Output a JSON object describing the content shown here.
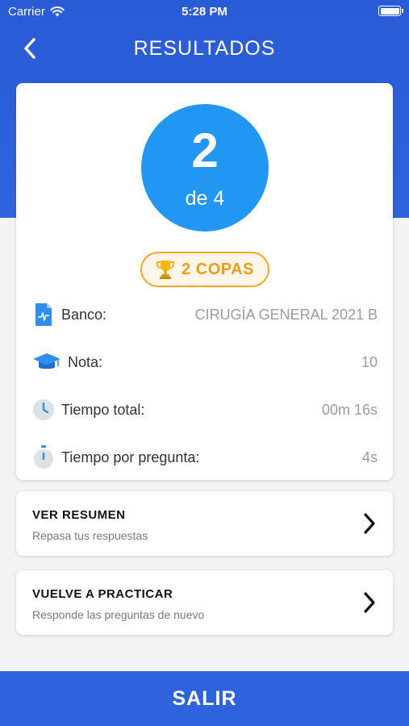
{
  "status_bar": {
    "carrier": "Carrier",
    "time": "5:28 PM"
  },
  "nav": {
    "title": "RESULTADOS"
  },
  "score": {
    "correct": "2",
    "total_label": "de 4"
  },
  "cups": {
    "label": "2 COPAS",
    "icon": "trophy-icon"
  },
  "info": [
    {
      "label": "Banco:",
      "value": "CIRUGÍA GENERAL 2021 B",
      "icon": "document-chart-icon"
    },
    {
      "label": "Nota:",
      "value": "10",
      "icon": "graduation-cap-icon"
    },
    {
      "label": "Tiempo total:",
      "value": "00m 16s",
      "icon": "clock-icon"
    },
    {
      "label": "Tiempo por pregunta:",
      "value": "4s",
      "icon": "stopwatch-icon"
    }
  ],
  "actions": [
    {
      "title": "VER RESUMEN",
      "subtitle": "Repasa tus respuestas"
    },
    {
      "title": "VUELVE A PRACTICAR",
      "subtitle": "Responde las preguntas de nuevo"
    }
  ],
  "exit": {
    "label": "SALIR"
  },
  "colors": {
    "primary": "#2f63de",
    "circle": "#2196f3",
    "accent": "#f5a623"
  }
}
